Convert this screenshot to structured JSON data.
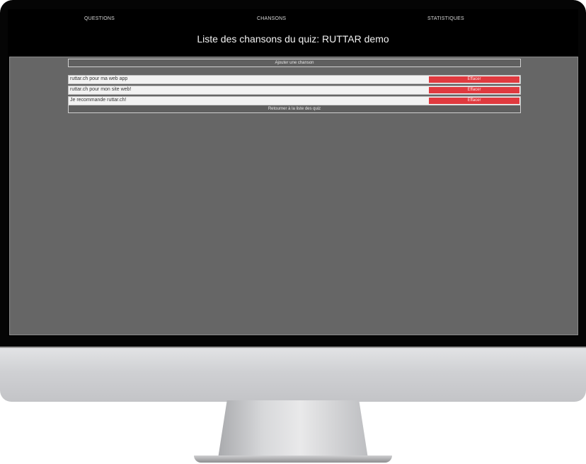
{
  "nav": {
    "questions": "QUESTIONS",
    "chansons": "CHANSONS",
    "statistiques": "STATISTIQUES"
  },
  "page_title": "Liste des chansons du quiz: RUTTAR demo",
  "add_button_label": "Ajouter une chanson",
  "songs": [
    {
      "title": "ruttar.ch pour ma web app",
      "delete_label": "Effacer"
    },
    {
      "title": "ruttar.ch pour mon site web!",
      "delete_label": "Effacer"
    },
    {
      "title": "Je recommande ruttar.ch!",
      "delete_label": "Effacer"
    }
  ],
  "back_button_label": "Retourner à la liste des quiz",
  "colors": {
    "background": "#000000",
    "content_bg": "#666666",
    "delete_red": "#e03a3f",
    "row_bg": "#f2f2f2"
  }
}
